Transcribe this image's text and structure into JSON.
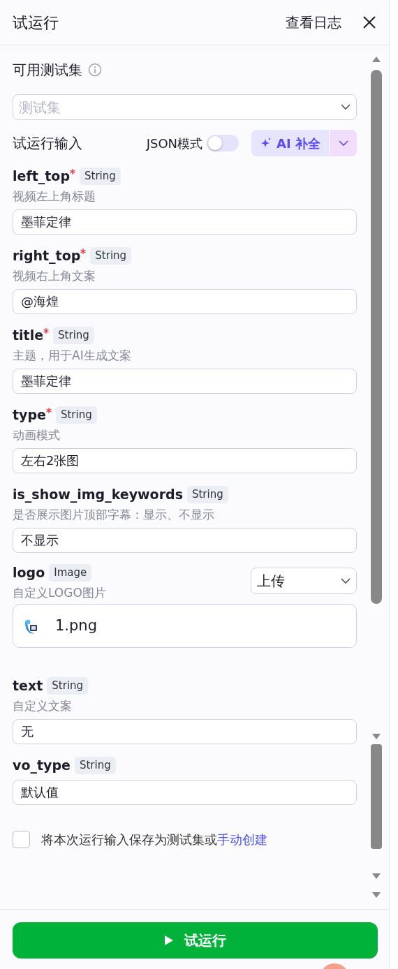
{
  "header": {
    "title": "试运行",
    "log_link": "查看日志"
  },
  "test_set": {
    "label": "可用测试集",
    "placeholder": "测试集"
  },
  "inputs_section": {
    "label": "试运行输入",
    "json_mode_label": "JSON模式",
    "json_mode_on": false,
    "ai_button": "AI 补全"
  },
  "fields": [
    {
      "kind": "text",
      "name": "left_top",
      "required": true,
      "type": "String",
      "description": "视频左上角标题",
      "value": "墨菲定律"
    },
    {
      "kind": "text",
      "name": "right_top",
      "required": true,
      "type": "String",
      "description": "视频右上角文案",
      "value": "@海煌"
    },
    {
      "kind": "text",
      "name": "title",
      "required": true,
      "type": "String",
      "description": "主题，用于AI生成文案",
      "value": "墨菲定律"
    },
    {
      "kind": "text",
      "name": "type",
      "required": true,
      "type": "String",
      "description": "动画模式",
      "value": "左右2张图"
    },
    {
      "kind": "text",
      "name": "is_show_img_keywords",
      "required": false,
      "type": "String",
      "description": "是否展示图片顶部字幕：显示、不显示",
      "value": "不显示"
    },
    {
      "kind": "upload",
      "name": "logo",
      "required": false,
      "type": "Image",
      "description": "自定义LOGO图片",
      "mode": "上传",
      "file_name": "1.png"
    },
    {
      "kind": "text",
      "name": "text",
      "required": false,
      "type": "String",
      "description": "自定义文案",
      "value": "无"
    },
    {
      "kind": "text",
      "name": "vo_type",
      "required": false,
      "type": "String",
      "value": "默认值"
    }
  ],
  "save_option": {
    "checked": false,
    "text": "将本次运行输入保存为测试集或",
    "link": "手动创建"
  },
  "run_button": "试运行"
}
